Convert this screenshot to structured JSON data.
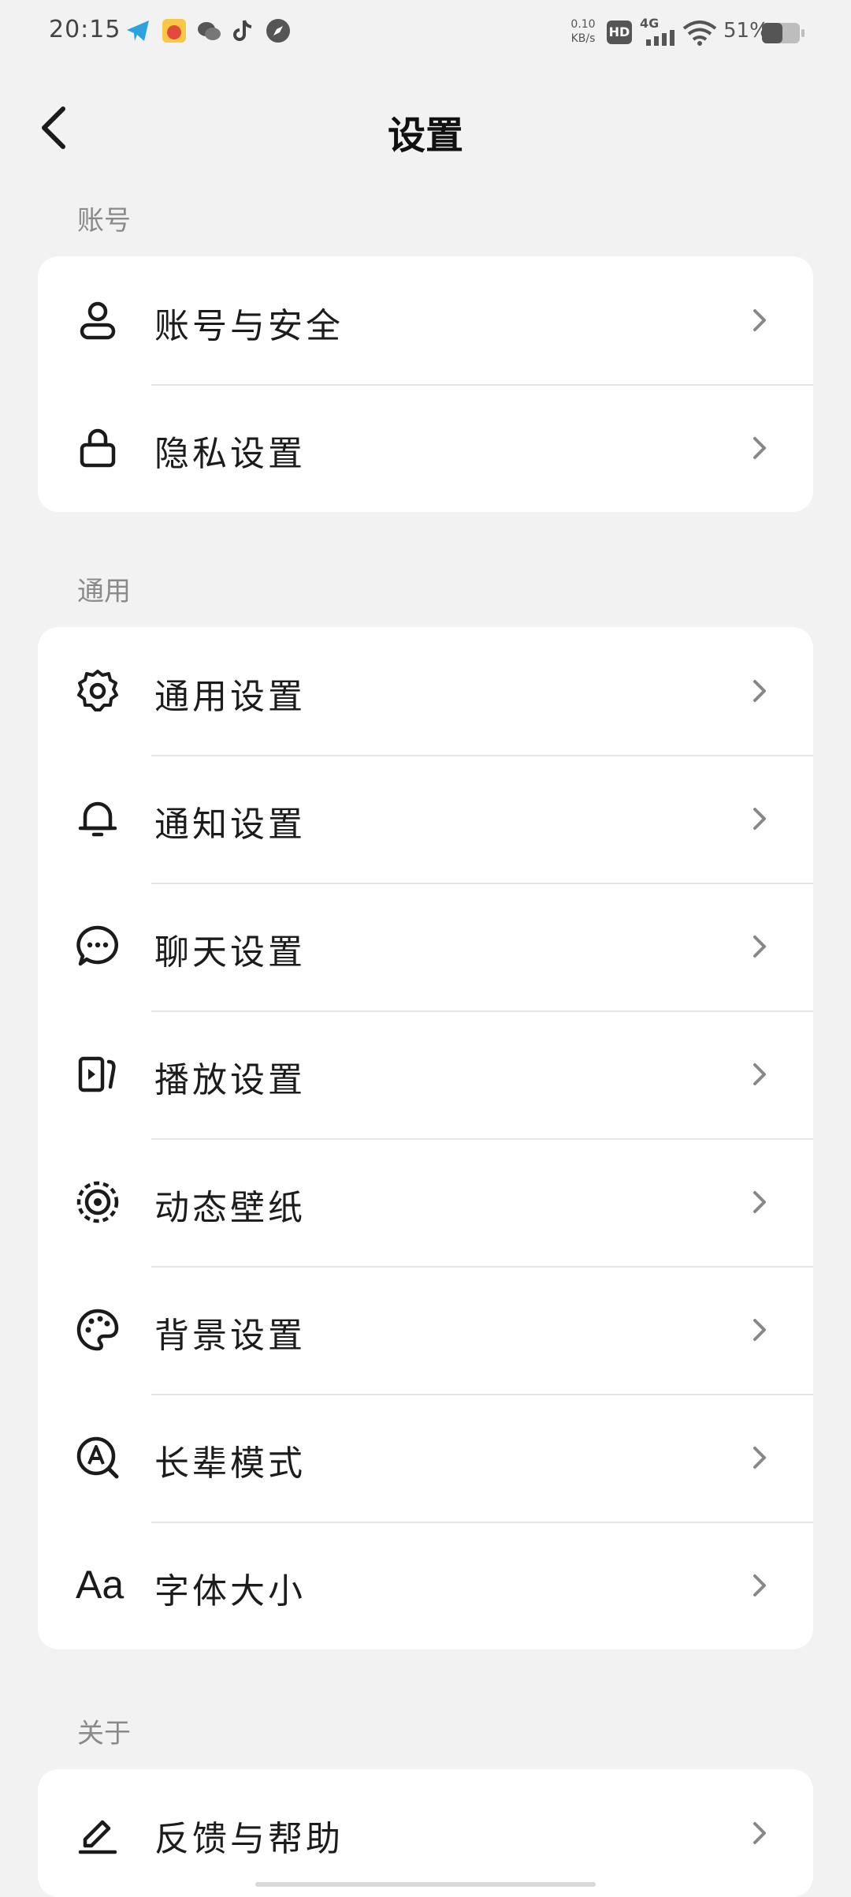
{
  "status_bar": {
    "time": "20:15",
    "net_speed_value": "0.10",
    "net_speed_unit": "KB/s",
    "hd_label": "HD",
    "signal_label": "4G",
    "battery": "51%"
  },
  "header": {
    "title": "设置"
  },
  "sections": [
    {
      "label": "账号",
      "items": [
        {
          "label": "账号与安全",
          "icon": "person-icon"
        },
        {
          "label": "隐私设置",
          "icon": "lock-icon"
        }
      ]
    },
    {
      "label": "通用",
      "items": [
        {
          "label": "通用设置",
          "icon": "gear-icon"
        },
        {
          "label": "通知设置",
          "icon": "bell-icon"
        },
        {
          "label": "聊天设置",
          "icon": "chat-bubble-icon"
        },
        {
          "label": "播放设置",
          "icon": "play-icon"
        },
        {
          "label": "动态壁纸",
          "icon": "live-wallpaper-icon"
        },
        {
          "label": "背景设置",
          "icon": "palette-icon"
        },
        {
          "label": "长辈模式",
          "icon": "elder-mode-icon"
        },
        {
          "label": "字体大小",
          "icon": "font-size-icon",
          "icon_text": "Aa"
        }
      ]
    },
    {
      "label": "关于",
      "items": [
        {
          "label": "反馈与帮助",
          "icon": "edit-pen-icon"
        }
      ]
    }
  ]
}
